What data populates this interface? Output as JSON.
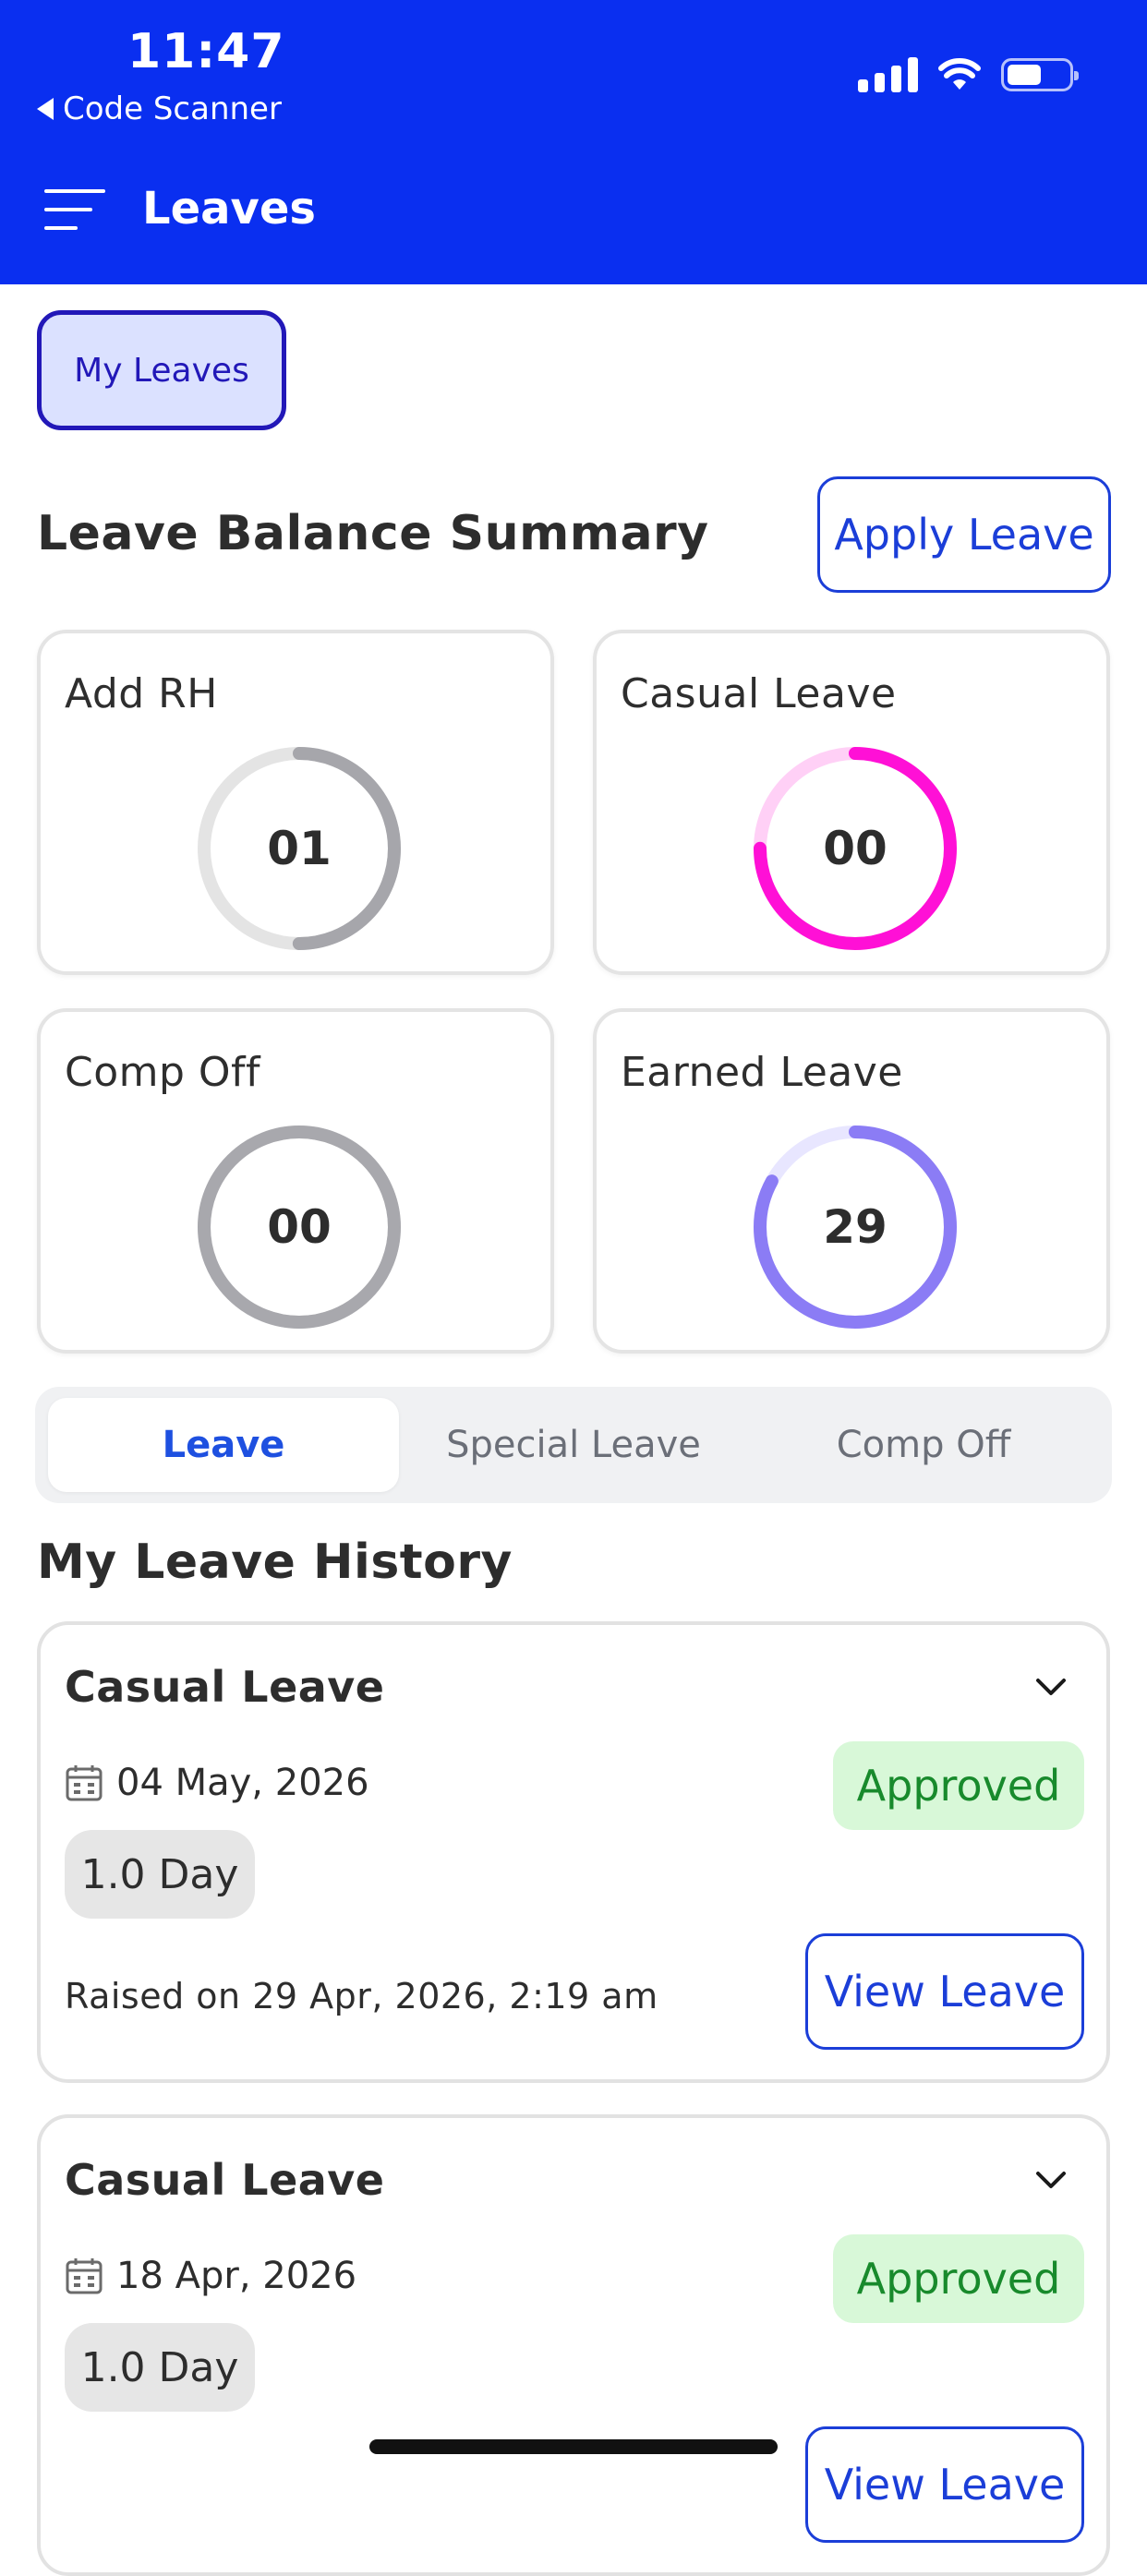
{
  "status_bar": {
    "time": "11:47",
    "back_app": "Code Scanner"
  },
  "header": {
    "title": "Leaves"
  },
  "chip": {
    "label": "My Leaves"
  },
  "summary": {
    "title": "Leave Balance Summary",
    "apply_label": "Apply Leave",
    "cards": [
      {
        "label": "Add RH",
        "value": "01",
        "fraction": 0.5,
        "color": "#a6a6ab",
        "track": "#e4e4e4"
      },
      {
        "label": "Casual Leave",
        "value": "00",
        "fraction": 0.75,
        "color": "#ff10d6",
        "track": "#ffd0f6"
      },
      {
        "label": "Comp Off",
        "value": "00",
        "fraction": 1.0,
        "color": "#a8a8ad",
        "track": "#e4e4e4"
      },
      {
        "label": "Earned Leave",
        "value": "29",
        "fraction": 0.83,
        "color": "#8b7cf5",
        "track": "#e8e6ff"
      }
    ]
  },
  "tabs": [
    {
      "label": "Leave",
      "active": true
    },
    {
      "label": "Special Leave",
      "active": false
    },
    {
      "label": "Comp Off",
      "active": false
    }
  ],
  "history": {
    "title": "My Leave History",
    "items": [
      {
        "type": "Casual Leave",
        "date": "04 May, 2026",
        "status": "Approved",
        "days": "1.0 Day",
        "raised": "Raised on 29 Apr, 2026, 2:19 am",
        "view_label": "View Leave"
      },
      {
        "type": "Casual Leave",
        "date": "18 Apr, 2026",
        "status": "Approved",
        "days": "1.0 Day",
        "raised": "",
        "view_label": "View Leave"
      }
    ]
  },
  "colors": {
    "header": "#0a2ff0",
    "accent": "#1b3ed8",
    "approved_bg": "#d8f8d8",
    "approved_text": "#188a2c"
  }
}
